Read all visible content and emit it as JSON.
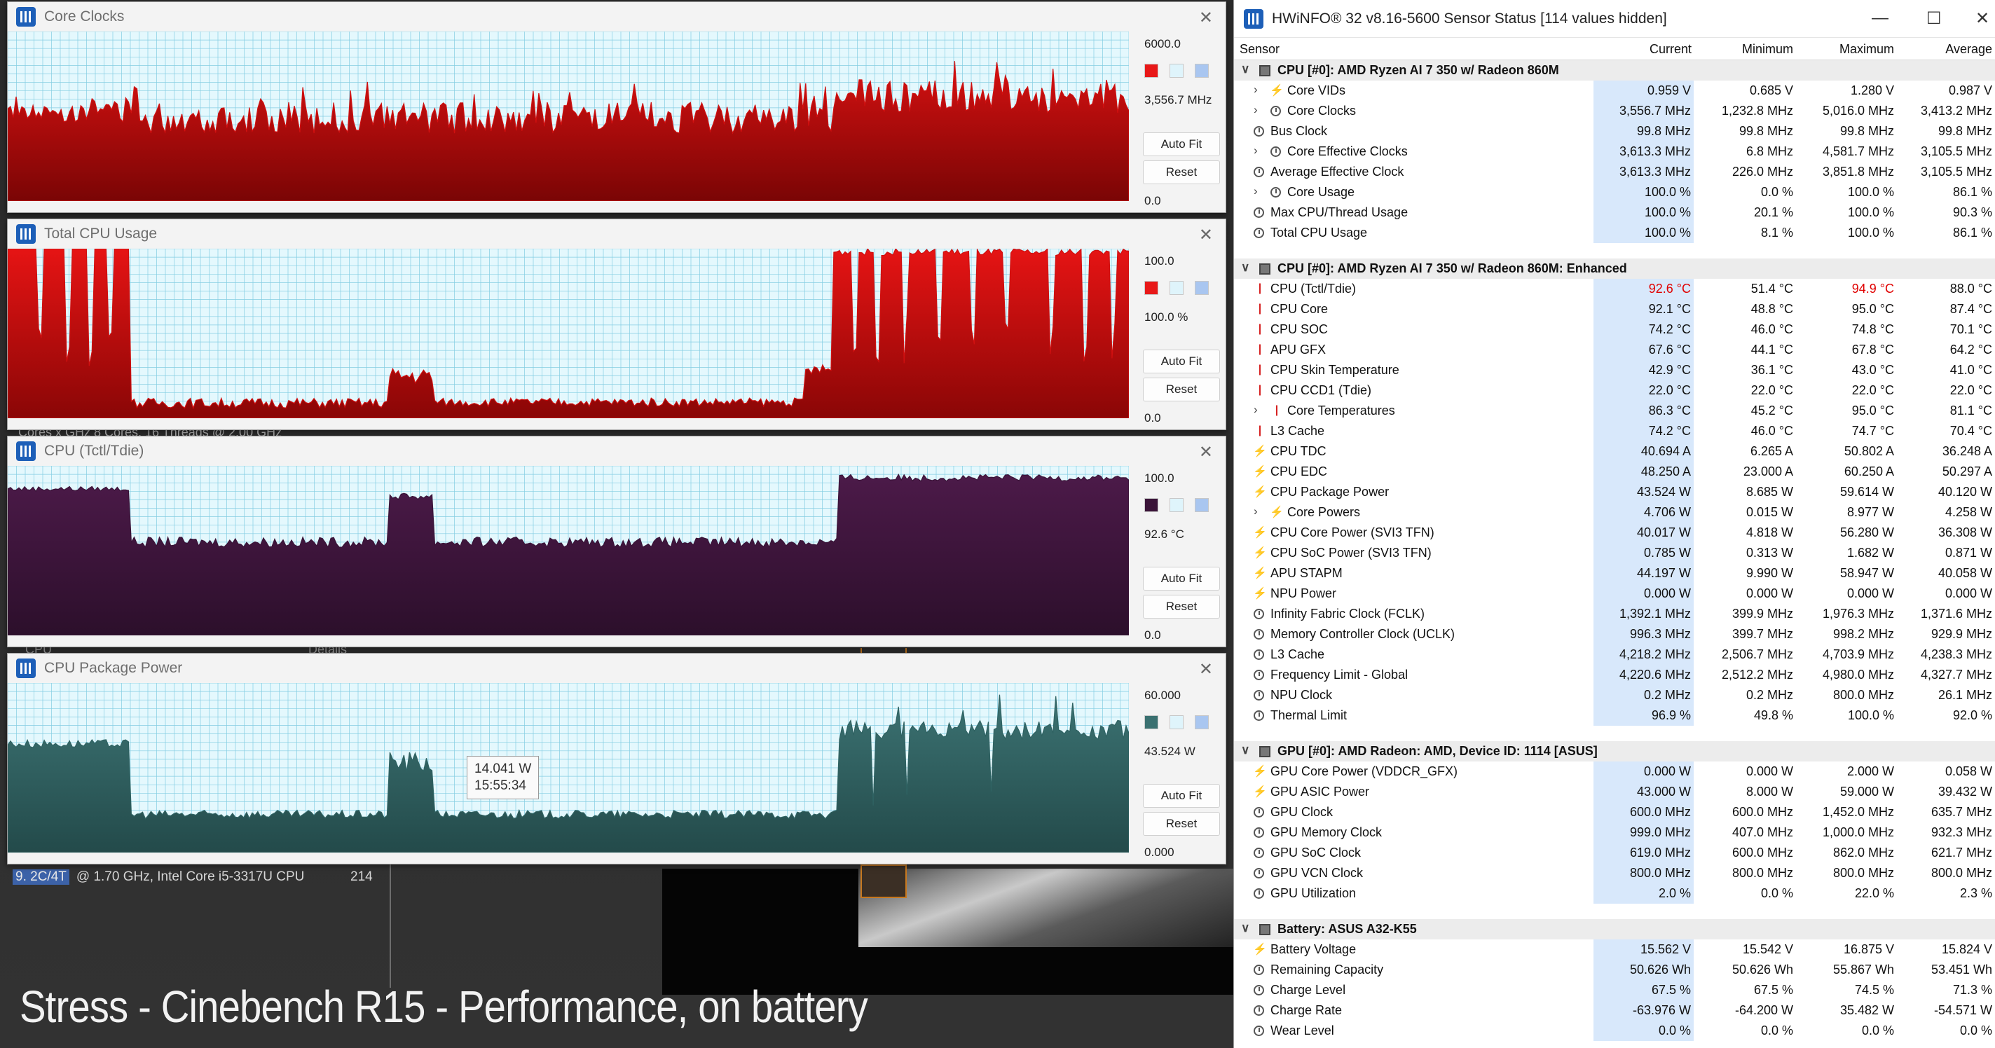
{
  "background": {
    "cpu_row_highlight": "9. 2C/4T",
    "cpu_row_text": "@ 1.70 GHz,  Intel Core i5-3317U CPU",
    "cpu_row_score": "214",
    "cores_note": "Cores x GHz   8 Cores, 16 Threads @ 2.00 GHz",
    "cpu_label": "CPU",
    "details_label": "Details",
    "caption": "Stress - Cinebench R15 - Performance, on battery"
  },
  "graphs": [
    {
      "title": "Core Clocks",
      "max": "6000.0",
      "current": "3,556.7 MHz",
      "min": "0.0",
      "color": "#d01010",
      "fill_top": "#d61111",
      "fill_bottom": "#7a0505",
      "swatch": "#e81818",
      "autofit_label": "Auto Fit",
      "reset_label": "Reset",
      "ymax": 6000,
      "segments": [
        [
          0,
          0.05,
          2900,
          3400
        ],
        [
          0.05,
          0.108,
          2800,
          3700
        ],
        [
          0.108,
          0.74,
          2400,
          3500
        ],
        [
          0.74,
          1.0,
          3100,
          4300
        ]
      ]
    },
    {
      "title": "Total CPU Usage",
      "max": "100.0",
      "current": "100.0 %",
      "min": "0.0",
      "color": "#d01010",
      "fill_top": "#e61414",
      "fill_bottom": "#8a0606",
      "swatch": "#e81818",
      "autofit_label": "Auto Fit",
      "reset_label": "Reset",
      "ymax": 100,
      "segments": [
        [
          0,
          0.108,
          100,
          100
        ],
        [
          0.108,
          0.34,
          6,
          12
        ],
        [
          0.34,
          0.38,
          20,
          30
        ],
        [
          0.38,
          0.71,
          7,
          12
        ],
        [
          0.71,
          0.735,
          25,
          32
        ],
        [
          0.735,
          1.0,
          96,
          100
        ]
      ],
      "dips": [
        0.03,
        0.055,
        0.075,
        0.092,
        0.755,
        0.775,
        0.8,
        0.83,
        0.86,
        0.89,
        0.93,
        0.96,
        0.985
      ]
    },
    {
      "title": "CPU (Tctl/Tdie)",
      "max": "100.0",
      "current": "92.6 °C",
      "min": "0.0",
      "color": "#3a1438",
      "fill_top": "#4c1a49",
      "fill_bottom": "#2c0f2b",
      "swatch": "#3a1438",
      "autofit_label": "Auto Fit",
      "reset_label": "Reset",
      "ymax": 100,
      "segments": [
        [
          0,
          0.108,
          85,
          88
        ],
        [
          0.108,
          0.34,
          52,
          58
        ],
        [
          0.34,
          0.38,
          80,
          84
        ],
        [
          0.38,
          0.74,
          52,
          58
        ],
        [
          0.74,
          1.0,
          91,
          95
        ]
      ]
    },
    {
      "title": "CPU Package Power",
      "max": "60.000",
      "current": "43.524 W",
      "min": "0.000",
      "color": "#2f6262",
      "fill_top": "#3c7373",
      "fill_bottom": "#234a4a",
      "swatch": "#3a7070",
      "autofit_label": "Auto Fit",
      "reset_label": "Reset",
      "ymax": 60,
      "segments": [
        [
          0,
          0.108,
          37,
          40
        ],
        [
          0.108,
          0.34,
          12,
          15
        ],
        [
          0.34,
          0.38,
          28,
          36
        ],
        [
          0.38,
          0.74,
          12,
          15
        ],
        [
          0.74,
          1.0,
          40,
          47
        ]
      ],
      "tooltip_value": "14.041 W",
      "tooltip_time": "15:55:34"
    }
  ],
  "hwinfo": {
    "title": "HWiNFO® 32 v8.16-5600 Sensor Status [114 values hidden]",
    "controls": {
      "minimize": "—",
      "maximize": "☐",
      "close": "✕"
    },
    "columns": [
      "Sensor",
      "Current",
      "Minimum",
      "Maximum",
      "Average"
    ],
    "rows": [
      {
        "type": "group",
        "name": "CPU [#0]: AMD Ryzen AI 7 350 w/ Radeon 860M"
      },
      {
        "icon": "bolt",
        "expand": true,
        "name": "Core VIDs",
        "vals": [
          "0.959 V",
          "0.685 V",
          "1.280 V",
          "0.987 V"
        ]
      },
      {
        "icon": "clock",
        "expand": true,
        "name": "Core Clocks",
        "vals": [
          "3,556.7 MHz",
          "1,232.8 MHz",
          "5,016.0 MHz",
          "3,413.2 MHz"
        ]
      },
      {
        "icon": "clock",
        "name": "Bus Clock",
        "vals": [
          "99.8 MHz",
          "99.8 MHz",
          "99.8 MHz",
          "99.8 MHz"
        ]
      },
      {
        "icon": "clock",
        "expand": true,
        "name": "Core Effective Clocks",
        "vals": [
          "3,613.3 MHz",
          "6.8 MHz",
          "4,581.7 MHz",
          "3,105.5 MHz"
        ]
      },
      {
        "icon": "clock",
        "name": "Average Effective Clock",
        "vals": [
          "3,613.3 MHz",
          "226.0 MHz",
          "3,851.8 MHz",
          "3,105.5 MHz"
        ]
      },
      {
        "icon": "clock",
        "expand": true,
        "name": "Core Usage",
        "vals": [
          "100.0 %",
          "0.0 %",
          "100.0 %",
          "86.1 %"
        ]
      },
      {
        "icon": "clock",
        "name": "Max CPU/Thread Usage",
        "vals": [
          "100.0 %",
          "20.1 %",
          "100.0 %",
          "90.3 %"
        ]
      },
      {
        "icon": "clock",
        "name": "Total CPU Usage",
        "vals": [
          "100.0 %",
          "8.1 %",
          "100.0 %",
          "86.1 %"
        ]
      },
      {
        "type": "blank"
      },
      {
        "type": "group",
        "name": "CPU [#0]: AMD Ryzen AI 7 350 w/ Radeon 860M: Enhanced"
      },
      {
        "icon": "temp",
        "name": "CPU (Tctl/Tdie)",
        "vals": [
          "92.6 °C",
          "51.4 °C",
          "94.9 °C",
          "88.0 °C"
        ],
        "hot": [
          0,
          2
        ]
      },
      {
        "icon": "temp",
        "name": "CPU Core",
        "vals": [
          "92.1 °C",
          "48.8 °C",
          "95.0 °C",
          "87.4 °C"
        ]
      },
      {
        "icon": "temp",
        "name": "CPU SOC",
        "vals": [
          "74.2 °C",
          "46.0 °C",
          "74.8 °C",
          "70.1 °C"
        ]
      },
      {
        "icon": "temp",
        "name": "APU GFX",
        "vals": [
          "67.6 °C",
          "44.1 °C",
          "67.8 °C",
          "64.2 °C"
        ]
      },
      {
        "icon": "temp",
        "name": "CPU Skin Temperature",
        "vals": [
          "42.9 °C",
          "36.1 °C",
          "43.0 °C",
          "41.0 °C"
        ]
      },
      {
        "icon": "temp",
        "name": "CPU CCD1 (Tdie)",
        "vals": [
          "22.0 °C",
          "22.0 °C",
          "22.0 °C",
          "22.0 °C"
        ]
      },
      {
        "icon": "temp",
        "expand": true,
        "name": "Core Temperatures",
        "vals": [
          "86.3 °C",
          "45.2 °C",
          "95.0 °C",
          "81.1 °C"
        ]
      },
      {
        "icon": "temp",
        "name": "L3 Cache",
        "vals": [
          "74.2 °C",
          "46.0 °C",
          "74.7 °C",
          "70.4 °C"
        ]
      },
      {
        "icon": "bolt",
        "name": "CPU TDC",
        "vals": [
          "40.694 A",
          "6.265 A",
          "50.802 A",
          "36.248 A"
        ]
      },
      {
        "icon": "bolt",
        "name": "CPU EDC",
        "vals": [
          "48.250 A",
          "23.000 A",
          "60.250 A",
          "50.297 A"
        ]
      },
      {
        "icon": "bolt",
        "name": "CPU Package Power",
        "vals": [
          "43.524 W",
          "8.685 W",
          "59.614 W",
          "40.120 W"
        ]
      },
      {
        "icon": "bolt",
        "expand": true,
        "name": "Core Powers",
        "vals": [
          "4.706 W",
          "0.015 W",
          "8.977 W",
          "4.258 W"
        ]
      },
      {
        "icon": "bolt",
        "name": "CPU Core Power (SVI3 TFN)",
        "vals": [
          "40.017 W",
          "4.818 W",
          "56.280 W",
          "36.308 W"
        ]
      },
      {
        "icon": "bolt",
        "name": "CPU SoC Power (SVI3 TFN)",
        "vals": [
          "0.785 W",
          "0.313 W",
          "1.682 W",
          "0.871 W"
        ]
      },
      {
        "icon": "bolt",
        "name": "APU STAPM",
        "vals": [
          "44.197 W",
          "9.990 W",
          "58.947 W",
          "40.058 W"
        ]
      },
      {
        "icon": "bolt",
        "name": "NPU Power",
        "vals": [
          "0.000 W",
          "0.000 W",
          "0.000 W",
          "0.000 W"
        ]
      },
      {
        "icon": "clock",
        "name": "Infinity Fabric Clock (FCLK)",
        "vals": [
          "1,392.1 MHz",
          "399.9 MHz",
          "1,976.3 MHz",
          "1,371.6 MHz"
        ]
      },
      {
        "icon": "clock",
        "name": "Memory Controller Clock (UCLK)",
        "vals": [
          "996.3 MHz",
          "399.7 MHz",
          "998.2 MHz",
          "929.9 MHz"
        ]
      },
      {
        "icon": "clock",
        "name": "L3 Cache",
        "vals": [
          "4,218.2 MHz",
          "2,506.7 MHz",
          "4,703.9 MHz",
          "4,238.3 MHz"
        ]
      },
      {
        "icon": "clock",
        "name": "Frequency Limit - Global",
        "vals": [
          "4,220.6 MHz",
          "2,512.2 MHz",
          "4,980.0 MHz",
          "4,327.7 MHz"
        ]
      },
      {
        "icon": "clock",
        "name": "NPU Clock",
        "vals": [
          "0.2 MHz",
          "0.2 MHz",
          "800.0 MHz",
          "26.1 MHz"
        ]
      },
      {
        "icon": "clock",
        "name": "Thermal Limit",
        "vals": [
          "96.9 %",
          "49.8 %",
          "100.0 %",
          "92.0 %"
        ]
      },
      {
        "type": "blank"
      },
      {
        "type": "group",
        "name": "GPU [#0]: AMD Radeon: AMD, Device ID: 1114 [ASUS]"
      },
      {
        "icon": "bolt",
        "name": "GPU Core Power (VDDCR_GFX)",
        "vals": [
          "0.000 W",
          "0.000 W",
          "2.000 W",
          "0.058 W"
        ]
      },
      {
        "icon": "bolt",
        "name": "GPU ASIC Power",
        "vals": [
          "43.000 W",
          "8.000 W",
          "59.000 W",
          "39.432 W"
        ]
      },
      {
        "icon": "clock",
        "name": "GPU Clock",
        "vals": [
          "600.0 MHz",
          "600.0 MHz",
          "1,452.0 MHz",
          "635.7 MHz"
        ]
      },
      {
        "icon": "clock",
        "name": "GPU Memory Clock",
        "vals": [
          "999.0 MHz",
          "407.0 MHz",
          "1,000.0 MHz",
          "932.3 MHz"
        ]
      },
      {
        "icon": "clock",
        "name": "GPU SoC Clock",
        "vals": [
          "619.0 MHz",
          "600.0 MHz",
          "862.0 MHz",
          "621.7 MHz"
        ]
      },
      {
        "icon": "clock",
        "name": "GPU VCN Clock",
        "vals": [
          "800.0 MHz",
          "800.0 MHz",
          "800.0 MHz",
          "800.0 MHz"
        ]
      },
      {
        "icon": "clock",
        "name": "GPU Utilization",
        "vals": [
          "2.0 %",
          "0.0 %",
          "22.0 %",
          "2.3 %"
        ]
      },
      {
        "type": "blank"
      },
      {
        "type": "group",
        "name": "Battery: ASUS  A32-K55"
      },
      {
        "icon": "bolt",
        "name": "Battery Voltage",
        "vals": [
          "15.562 V",
          "15.542 V",
          "16.875 V",
          "15.824 V"
        ]
      },
      {
        "icon": "clock",
        "name": "Remaining Capacity",
        "vals": [
          "50.626 Wh",
          "50.626 Wh",
          "55.867 Wh",
          "53.451 Wh"
        ]
      },
      {
        "icon": "clock",
        "name": "Charge Level",
        "vals": [
          "67.5 %",
          "67.5 %",
          "74.5 %",
          "71.3 %"
        ]
      },
      {
        "icon": "clock",
        "name": "Charge Rate",
        "vals": [
          "-63.976 W",
          "-64.200 W",
          "35.482 W",
          "-54.571 W"
        ]
      },
      {
        "icon": "clock",
        "name": "Wear Level",
        "vals": [
          "0.0 %",
          "0.0 %",
          "0.0 %",
          "0.0 %"
        ]
      }
    ]
  }
}
